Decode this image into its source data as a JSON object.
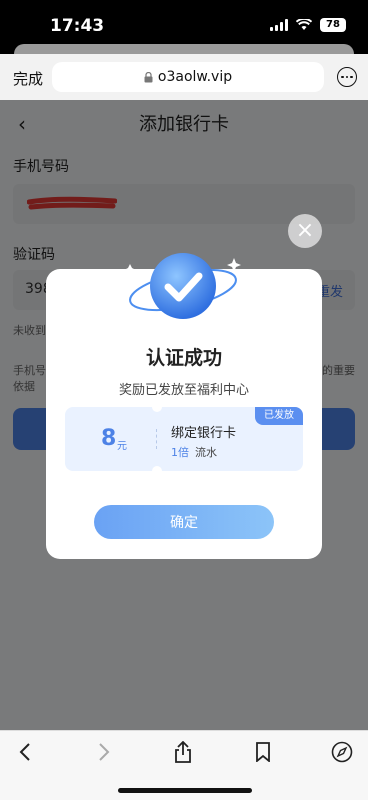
{
  "status_bar": {
    "time": "17:43",
    "battery": "78",
    "icons": [
      "signal-icon",
      "wifi-icon",
      "battery-icon"
    ]
  },
  "browser": {
    "done_label": "完成",
    "url": "o3aolw.vip",
    "icons": [
      "lock-icon",
      "more-icon"
    ]
  },
  "page": {
    "title": "添加银行卡",
    "phone_label": "手机号码",
    "code_label": "验证码",
    "code_partial": "398",
    "resend_partial": "重发",
    "hint_partial": "未收到",
    "note_line1_left": "手机号",
    "note_line1_right": "的重要",
    "note_line2": "依据"
  },
  "modal": {
    "title": "认证成功",
    "subtitle": "奖励已发放至福利中心",
    "reward": {
      "amount": "8",
      "unit": "元",
      "name": "绑定银行卡",
      "multiplier": "1倍",
      "flow": "流水",
      "badge": "已发放"
    },
    "confirm_label": "确定"
  },
  "toolbar": {
    "icons": [
      "back-arrow-icon",
      "forward-arrow-icon",
      "share-icon",
      "bookmarks-icon",
      "compass-icon"
    ]
  },
  "colors": {
    "accent": "#4d82e6",
    "overlay": "rgba(0,0,0,0.5)"
  }
}
